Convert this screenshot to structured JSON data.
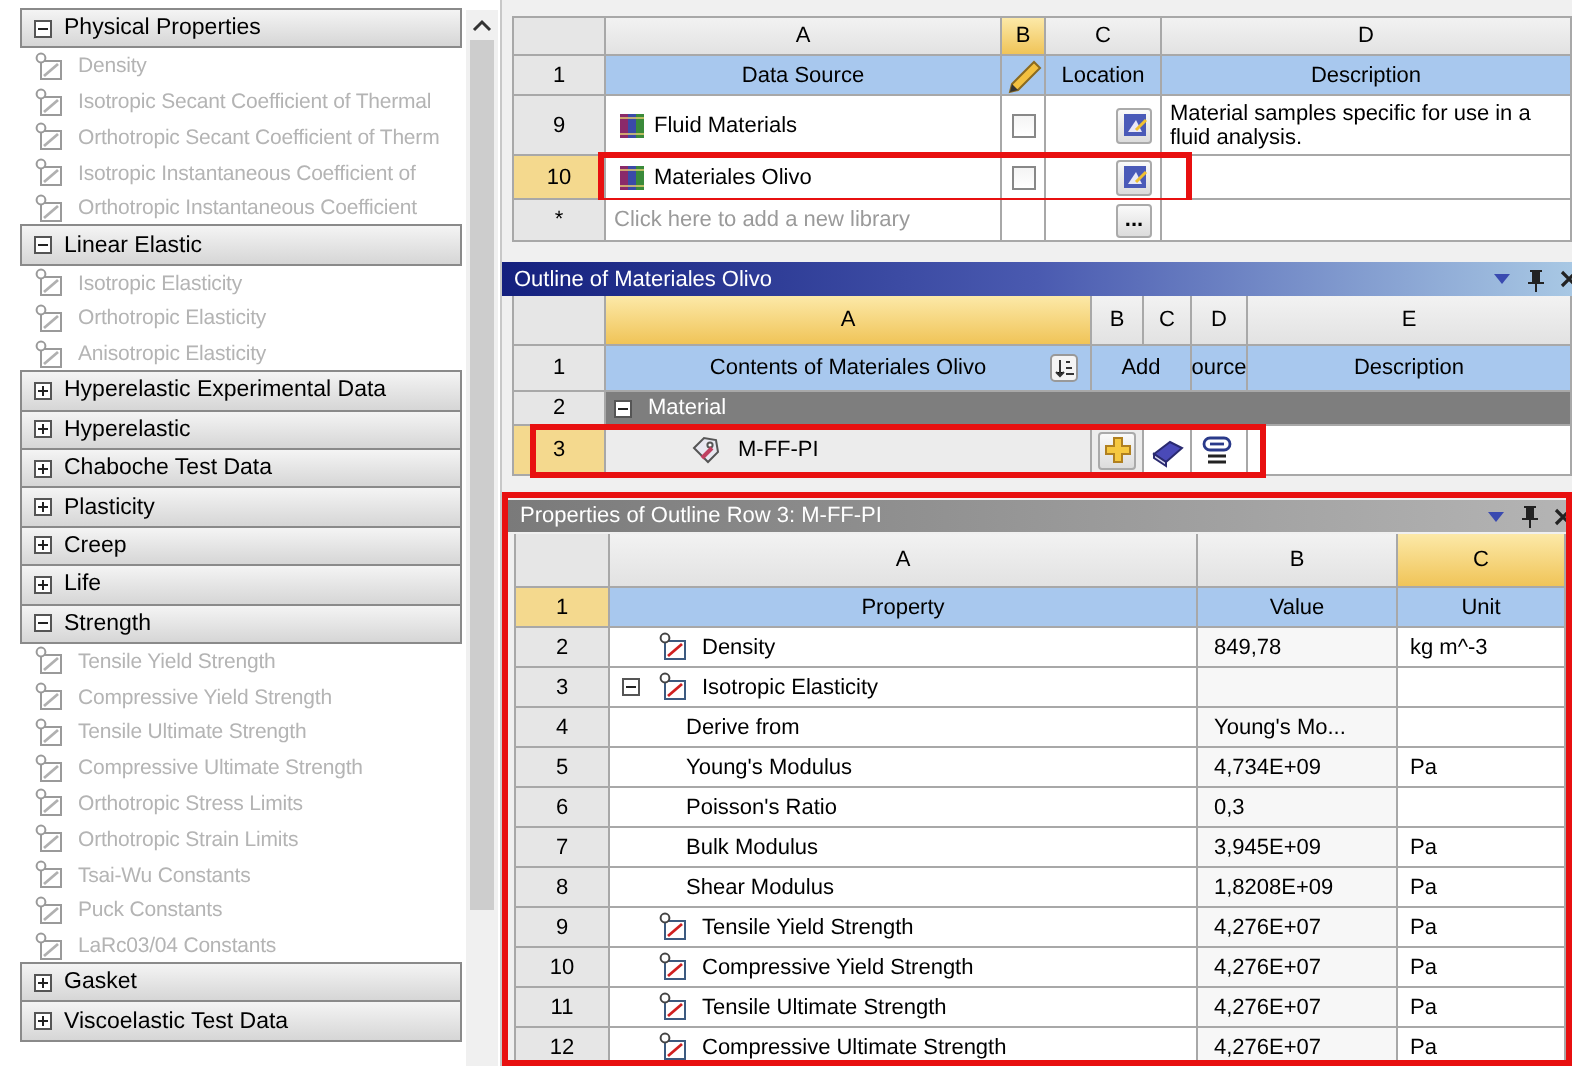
{
  "toolbox": {
    "groups": [
      {
        "label": "Physical Properties",
        "expanded": true,
        "children": [
          {
            "label": "Density",
            "disabled": true
          },
          {
            "label": "Isotropic Secant Coefficient of Thermal",
            "disabled": true
          },
          {
            "label": "Orthotropic Secant Coefficient of Therm",
            "disabled": true
          },
          {
            "label": "Isotropic Instantaneous Coefficient of",
            "disabled": true
          },
          {
            "label": "Orthotropic Instantaneous Coefficient",
            "disabled": true
          }
        ]
      },
      {
        "label": "Linear Elastic",
        "expanded": true,
        "children": [
          {
            "label": "Isotropic Elasticity",
            "disabled": true
          },
          {
            "label": "Orthotropic Elasticity",
            "disabled": true
          },
          {
            "label": "Anisotropic Elasticity",
            "disabled": true
          }
        ]
      },
      {
        "label": "Hyperelastic Experimental Data",
        "expanded": false
      },
      {
        "label": "Hyperelastic",
        "expanded": false
      },
      {
        "label": "Chaboche Test Data",
        "expanded": false
      },
      {
        "label": "Plasticity",
        "expanded": false
      },
      {
        "label": "Creep",
        "expanded": false
      },
      {
        "label": "Life",
        "expanded": false
      },
      {
        "label": "Strength",
        "expanded": true,
        "children": [
          {
            "label": "Tensile Yield Strength",
            "disabled": true
          },
          {
            "label": "Compressive Yield Strength",
            "disabled": true
          },
          {
            "label": "Tensile Ultimate Strength",
            "disabled": true
          },
          {
            "label": "Compressive Ultimate Strength",
            "disabled": true
          },
          {
            "label": "Orthotropic Stress Limits",
            "disabled": true
          },
          {
            "label": "Orthotropic Strain Limits",
            "disabled": true
          },
          {
            "label": "Tsai-Wu Constants",
            "disabled": true
          },
          {
            "label": "Puck Constants",
            "disabled": true
          },
          {
            "label": "LaRc03/04 Constants",
            "disabled": true
          }
        ]
      },
      {
        "label": "Gasket",
        "expanded": false
      },
      {
        "label": "Viscoelastic Test Data",
        "expanded": false
      }
    ]
  },
  "library_table": {
    "columns": [
      {
        "letter": "A",
        "selected": false
      },
      {
        "letter": "B",
        "selected": true
      },
      {
        "letter": "C",
        "selected": false
      },
      {
        "letter": "D",
        "selected": false
      }
    ],
    "header": {
      "number": "1",
      "data_source": "Data Source",
      "location": "Location",
      "description": "Description"
    },
    "rows": [
      {
        "number": "9",
        "name": "Fluid Materials",
        "checked": false,
        "description": "Material samples specific for use in a fluid analysis.",
        "selected": false,
        "highlighted": false
      },
      {
        "number": "10",
        "name": "Materiales Olivo",
        "checked": false,
        "selected": true,
        "highlighted": true
      }
    ],
    "new_row": {
      "number": "*",
      "placeholder": "Click here to add a new library",
      "button": "..."
    }
  },
  "outline": {
    "title": "Outline of Materiales Olivo",
    "columns": [
      {
        "letter": "A",
        "selected": true
      },
      {
        "letter": "B",
        "selected": false
      },
      {
        "letter": "C",
        "selected": false
      },
      {
        "letter": "D",
        "selected": false
      },
      {
        "letter": "E",
        "selected": false
      }
    ],
    "header": {
      "number": "1",
      "contents": "Contents of Materiales Olivo",
      "add": "Add",
      "source": "ource",
      "description": "Description"
    },
    "category": {
      "number": "2",
      "label": "Material",
      "expanded": true
    },
    "rows": [
      {
        "number": "3",
        "name": "M-FF-PI",
        "selected": true,
        "highlighted": true
      }
    ]
  },
  "properties": {
    "title": "Properties of Outline Row 3: M-FF-PI",
    "highlighted": true,
    "columns": [
      {
        "letter": "A",
        "selected": false
      },
      {
        "letter": "B",
        "selected": false
      },
      {
        "letter": "C",
        "selected": true
      }
    ],
    "header": {
      "number": "1",
      "property": "Property",
      "value": "Value",
      "unit": "Unit",
      "selected": true
    },
    "rows": [
      {
        "number": "2",
        "kind": "property",
        "name": "Density",
        "value": "849,78",
        "unit": "kg m^-3"
      },
      {
        "number": "3",
        "kind": "property",
        "name": "Isotropic Elasticity",
        "expanded": true,
        "children": [
          {
            "number": "4",
            "kind": "parameter",
            "name": "Derive from",
            "value": "Young's Mo..."
          },
          {
            "number": "5",
            "kind": "parameter",
            "name": "Young's Modulus",
            "value": "4,734E+09",
            "unit": "Pa"
          },
          {
            "number": "6",
            "kind": "parameter",
            "name": "Poisson's Ratio",
            "value": "0,3"
          },
          {
            "number": "7",
            "kind": "parameter",
            "name": "Bulk Modulus",
            "value": "3,945E+09",
            "unit": "Pa"
          },
          {
            "number": "8",
            "kind": "parameter",
            "name": "Shear Modulus",
            "value": "1,8208E+09",
            "unit": "Pa"
          }
        ]
      },
      {
        "number": "9",
        "kind": "property",
        "name": "Tensile Yield Strength",
        "value": "4,276E+07",
        "unit": "Pa"
      },
      {
        "number": "10",
        "kind": "property",
        "name": "Compressive Yield Strength",
        "value": "4,276E+07",
        "unit": "Pa"
      },
      {
        "number": "11",
        "kind": "property",
        "name": "Tensile Ultimate Strength",
        "value": "4,276E+07",
        "unit": "Pa"
      },
      {
        "number": "12",
        "kind": "property",
        "name": "Compressive Ultimate Strength",
        "value": "4,276E+07",
        "unit": "Pa"
      }
    ]
  }
}
